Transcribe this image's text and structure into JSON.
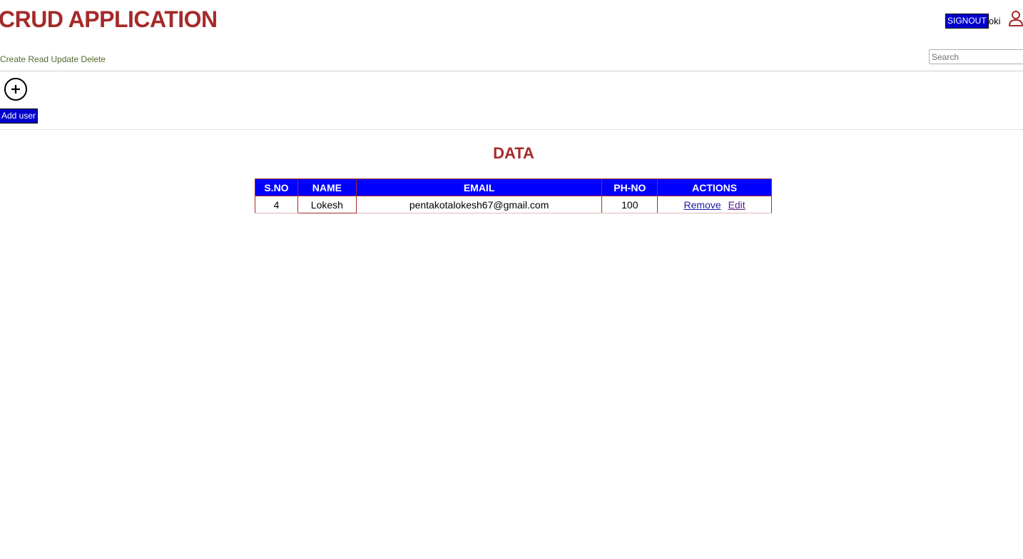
{
  "header": {
    "title": "CRUD APPLICATION",
    "tagline": "Create Read Update Delete",
    "signout_label": "SIGNOUT",
    "username": "loki",
    "search_placeholder": "Search"
  },
  "toolbar": {
    "add_icon": "plus-circle-icon",
    "add_user_label": "Add user"
  },
  "data_section": {
    "title": "DATA",
    "columns": [
      "S.NO",
      "NAME",
      "EMAIL",
      "PH-NO",
      "ACTIONS"
    ],
    "rows": [
      {
        "sno": "4",
        "name": "Lokesh",
        "email": "pentakotalokesh67@gmail.com",
        "phone": "100",
        "remove_label": "Remove",
        "edit_label": "Edit"
      }
    ]
  },
  "colors": {
    "title": "#a52a2a",
    "tagline": "#556b2f",
    "button_bg": "#0000cd",
    "table_header_bg": "#0000ff",
    "table_border": "#a52a2a"
  },
  "icons": {
    "user": "user-icon",
    "add": "plus-circle-icon"
  }
}
